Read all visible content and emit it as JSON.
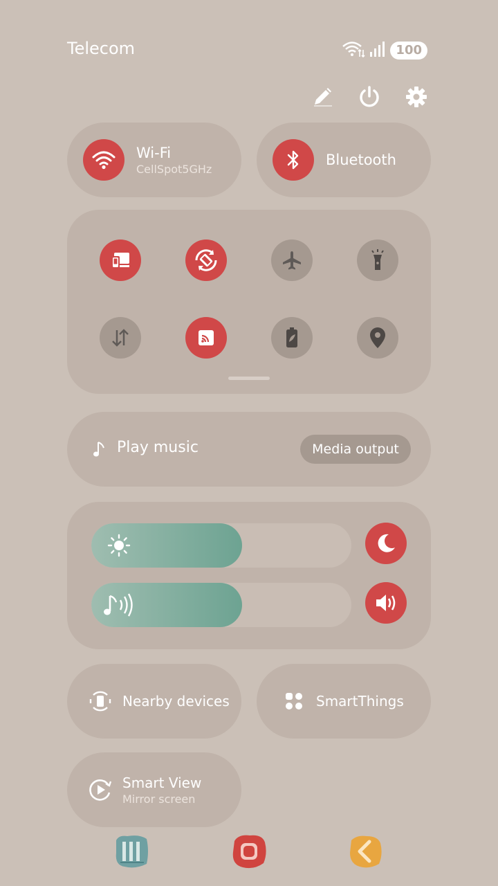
{
  "status": {
    "carrier": "Telecom",
    "battery": "100",
    "icons": [
      "wifi-data-icon",
      "signal-icon",
      "battery-icon"
    ]
  },
  "top_actions": [
    "edit-pencil-icon",
    "power-icon",
    "settings-gear-icon"
  ],
  "wifi": {
    "title": "Wi-Fi",
    "network": "CellSpot5GHz",
    "on": true
  },
  "bluetooth": {
    "title": "Bluetooth",
    "on": true
  },
  "quick_toggles": [
    {
      "name": "screen-share-icon",
      "on": true
    },
    {
      "name": "auto-rotate-icon",
      "on": true
    },
    {
      "name": "airplane-icon",
      "on": false
    },
    {
      "name": "flashlight-icon",
      "on": false
    },
    {
      "name": "mobile-data-icon",
      "on": false
    },
    {
      "name": "cast-icon",
      "on": true
    },
    {
      "name": "power-saving-icon",
      "on": false
    },
    {
      "name": "location-icon",
      "on": false
    }
  ],
  "media": {
    "label": "Play music",
    "output_button": "Media output"
  },
  "sliders": {
    "brightness": {
      "level": 0.58,
      "icon": "sun-icon"
    },
    "volume": {
      "level": 0.58,
      "icon": "music-note-volume-icon"
    }
  },
  "side_buttons": [
    "night-mode-moon-icon",
    "sound-speaker-icon"
  ],
  "nearby": {
    "title": "Nearby devices"
  },
  "smartthings": {
    "title": "SmartThings"
  },
  "smartview": {
    "title": "Smart View",
    "subtitle": "Mirror screen"
  },
  "nav": [
    "recent-apps-icon",
    "home-icon",
    "back-icon"
  ],
  "colors": {
    "accent": "#d04848",
    "off": "#a59990",
    "slider": "#6da392",
    "panel": "#c0b3aa",
    "background": "#cbc0b7"
  }
}
